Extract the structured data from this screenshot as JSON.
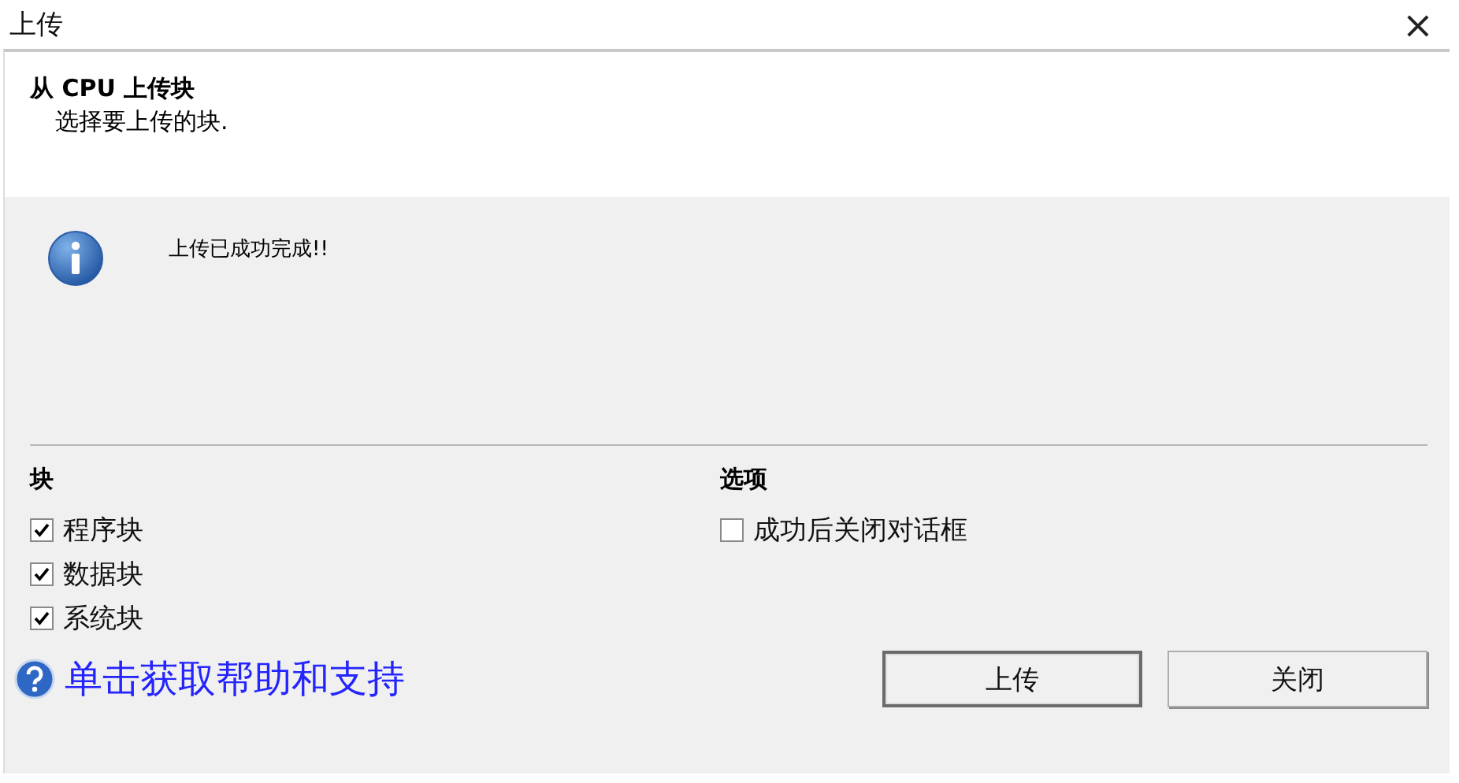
{
  "window": {
    "title": "上传",
    "close": "×"
  },
  "header": {
    "title": "从 CPU 上传块",
    "subtitle": "选择要上传的块."
  },
  "message": {
    "text": "上传已成功完成!!"
  },
  "blocks": {
    "title": "块",
    "items": [
      {
        "label": "程序块",
        "checked": true
      },
      {
        "label": "数据块",
        "checked": true
      },
      {
        "label": "系统块",
        "checked": true
      }
    ]
  },
  "options": {
    "title": "选项",
    "items": [
      {
        "label": "成功后关闭对话框",
        "checked": false
      }
    ]
  },
  "help_link": "单击获取帮助和支持",
  "buttons": [
    {
      "label": "上传",
      "default": true
    },
    {
      "label": "关闭",
      "default": false
    }
  ]
}
